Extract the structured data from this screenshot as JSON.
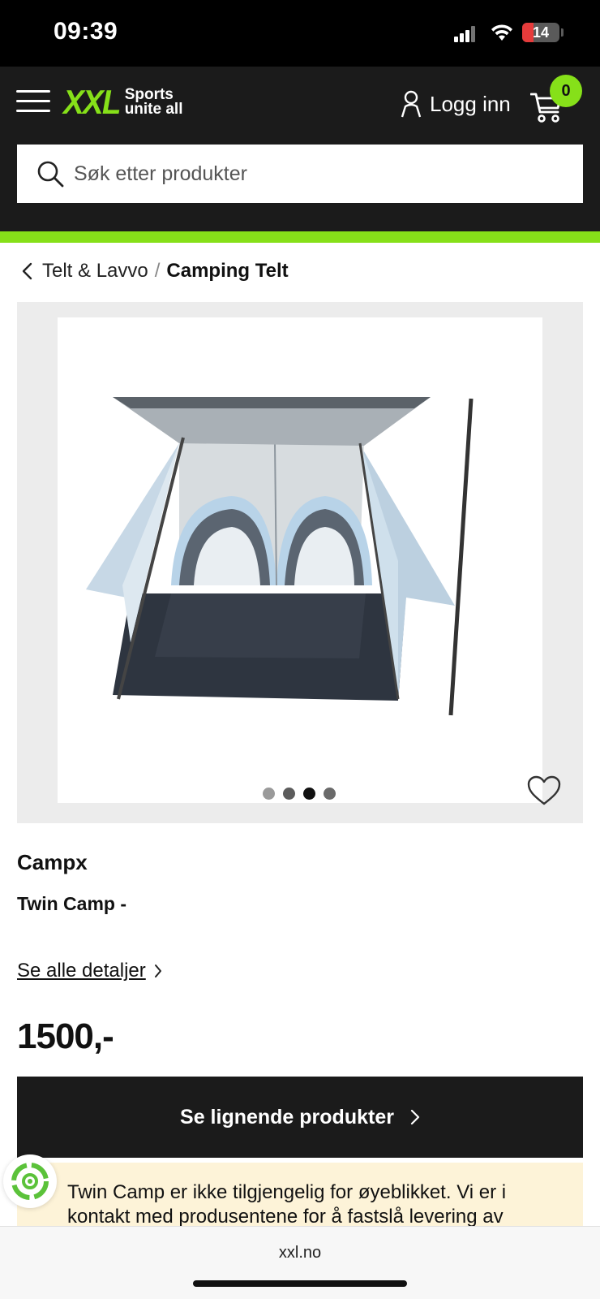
{
  "status_bar": {
    "time": "09:39",
    "battery": "14"
  },
  "header": {
    "logo_main": "XXL",
    "logo_tagline_1": "Sports",
    "logo_tagline_2": "unite all",
    "login_label": "Logg inn",
    "cart_count": "0",
    "search_placeholder": "Søk etter produkter"
  },
  "breadcrumb": {
    "parent": "Telt & Lavvo",
    "separator": "/",
    "current": "Camping Telt"
  },
  "gallery": {
    "image_alt": "Twin Camp tent",
    "dots": [
      {
        "active": false
      },
      {
        "active": false
      },
      {
        "active": true
      },
      {
        "active": false
      }
    ]
  },
  "product": {
    "brand": "Campx",
    "name": "Twin Camp -",
    "details_link": "Se alle detaljer",
    "price": "1500,-",
    "cta_label": "Se lignende produkter",
    "notice": "Twin Camp er ikke tilgjengelig for øyeblikket. Vi er i kontakt med produsentene for å fastslå levering av"
  },
  "browser": {
    "url": "xxl.no"
  },
  "colors": {
    "brand_green": "#86e019",
    "header_bg": "#1b1b1b",
    "notice_bg": "#fdf3d8"
  }
}
